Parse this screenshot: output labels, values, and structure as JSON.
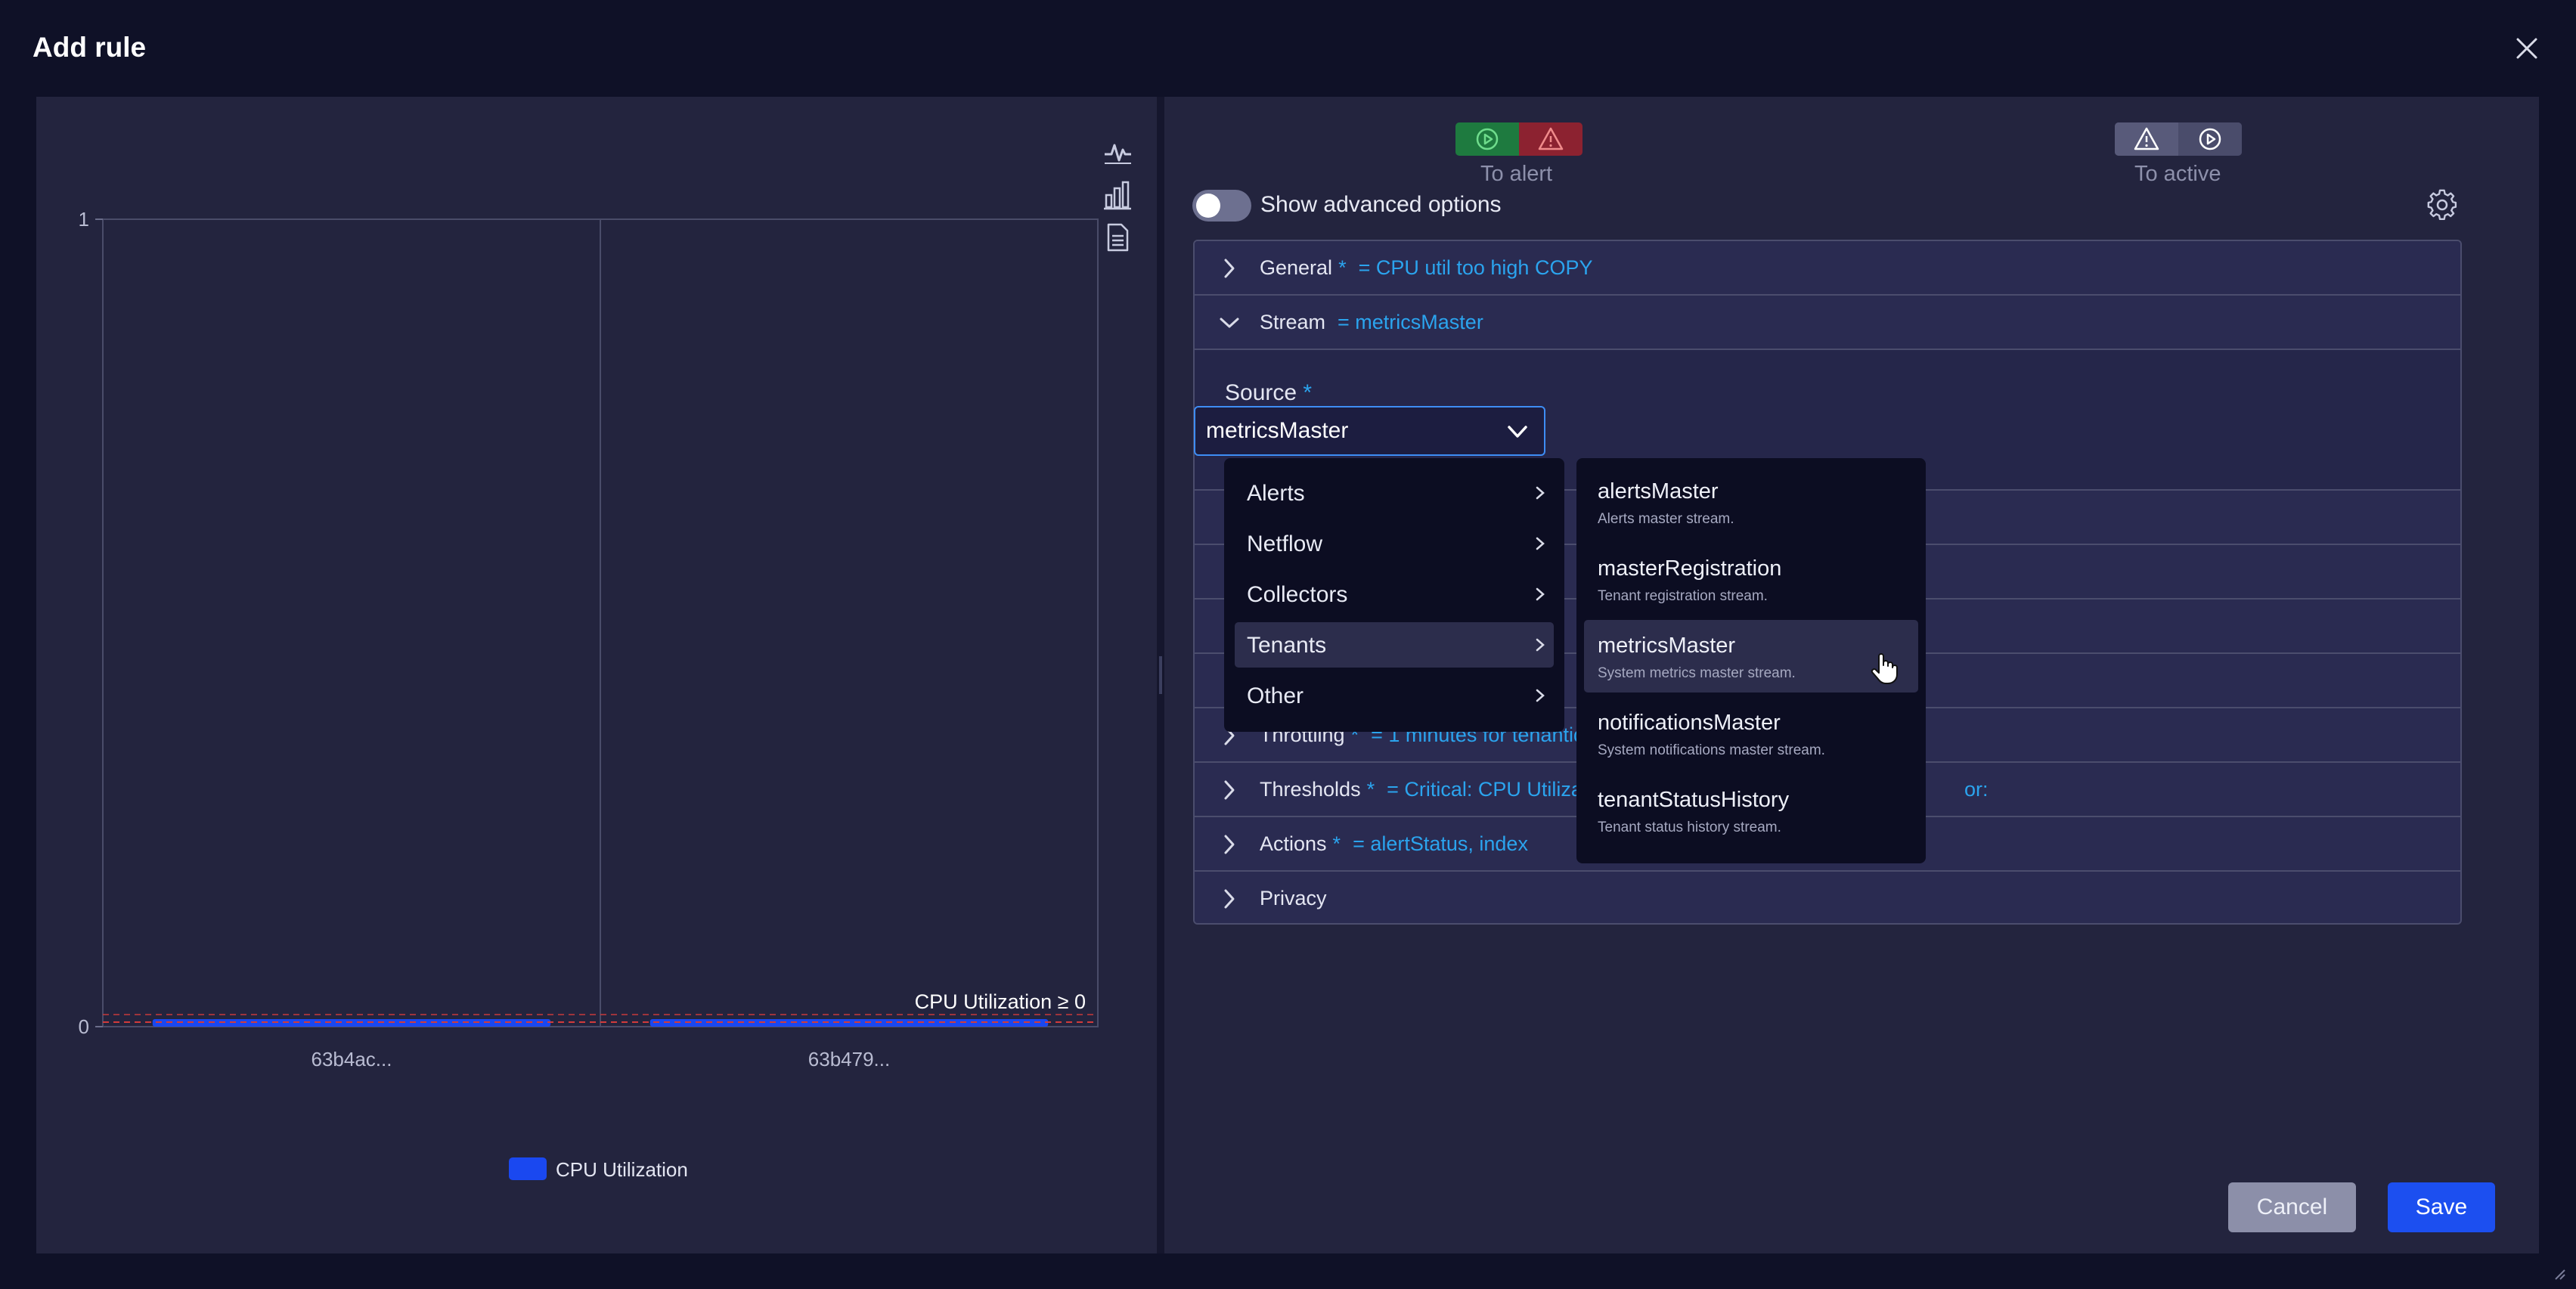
{
  "dialog": {
    "title": "Add rule"
  },
  "chart_data": {
    "type": "bar",
    "categories": [
      "63b4ac...",
      "63b479..."
    ],
    "series": [
      {
        "name": "CPU Utilization",
        "values": [
          0,
          0
        ]
      }
    ],
    "ylim": [
      0,
      1
    ],
    "yticks": [
      "0",
      "1"
    ],
    "threshold_label": "CPU Utilization ≥ 0",
    "legend_position": "bottom",
    "colors": {
      "series": "#1a48f0",
      "threshold": "#d23b3b"
    }
  },
  "chart_toolbar": [
    "line-chart-icon",
    "bar-chart-icon",
    "document-icon"
  ],
  "flow": {
    "to_alert_label": "To alert",
    "to_active_label": "To active"
  },
  "advanced": {
    "label": "Show advanced options",
    "enabled": false
  },
  "sections": {
    "general": {
      "label": "General",
      "req": "*",
      "value": "= CPU util too high COPY"
    },
    "stream": {
      "label": "Stream",
      "value": "= metricsMaster"
    },
    "throttling": {
      "label": "Throttling",
      "req": "*",
      "value": "= 1 minutes for tenantid"
    },
    "thresholds": {
      "label": "Thresholds",
      "req": "*",
      "value": "= Critical: CPU Utilizatio",
      "value_tail": "or:"
    },
    "actions": {
      "label": "Actions",
      "req": "*",
      "value": "= alertStatus, index"
    },
    "privacy": {
      "label": "Privacy"
    }
  },
  "source": {
    "label": "Source",
    "req": "*",
    "value": "metricsMaster"
  },
  "categories_menu": [
    "Alerts",
    "Netflow",
    "Collectors",
    "Tenants",
    "Other"
  ],
  "stream_options": [
    {
      "name": "alertsMaster",
      "desc": "Alerts master stream."
    },
    {
      "name": "masterRegistration",
      "desc": "Tenant registration stream."
    },
    {
      "name": "metricsMaster",
      "desc": "System metrics master stream."
    },
    {
      "name": "notificationsMaster",
      "desc": "System notifications master stream."
    },
    {
      "name": "tenantStatusHistory",
      "desc": "Tenant status history stream."
    }
  ],
  "buttons": {
    "cancel": "Cancel",
    "save": "Save"
  }
}
